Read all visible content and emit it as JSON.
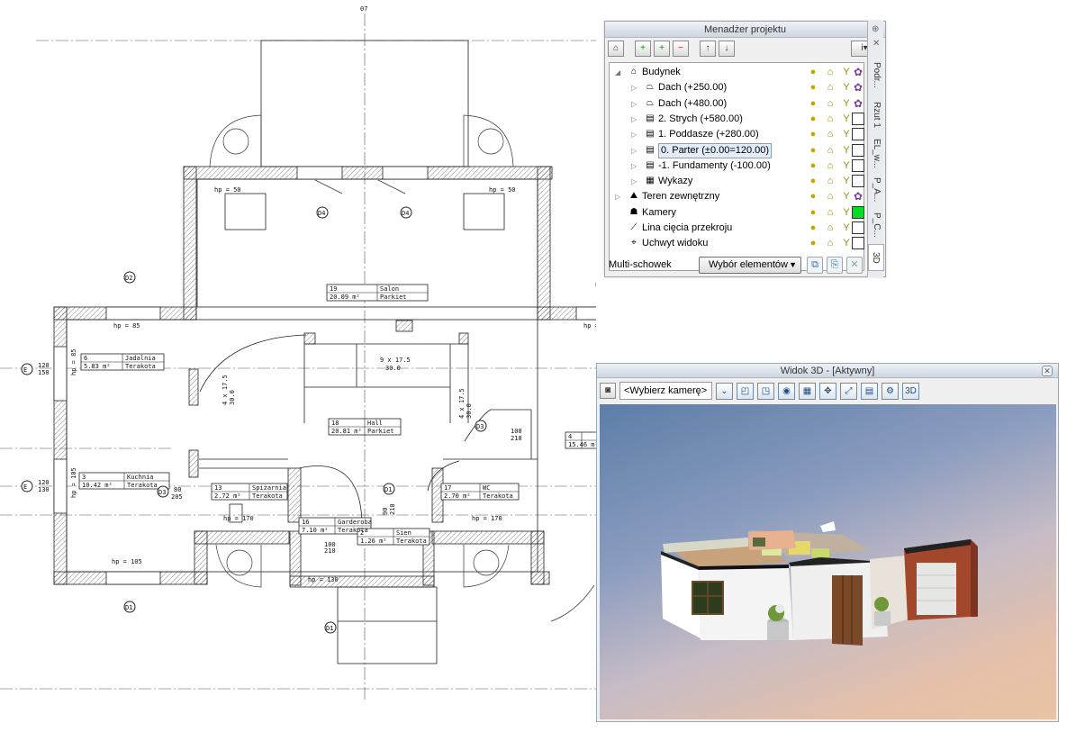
{
  "floor_plan": {
    "axis_labels": [
      "07",
      "D2",
      "D4",
      "D4",
      "D3",
      "D1",
      "D1",
      "E",
      "E",
      "D1",
      "D5",
      "D3"
    ],
    "room_labels": [
      {
        "number": "19",
        "name": "Salon",
        "area": "20.09 m²",
        "floor": "Parkiet"
      },
      {
        "number": "6",
        "name": "Jadalnia",
        "area": "5.83 m²",
        "floor": "Terakota"
      },
      {
        "number": "18",
        "name": "Hall",
        "area": "20.81 m²",
        "floor": "Parkiet"
      },
      {
        "number": "3",
        "name": "Kuchnia",
        "area": "10.42 m²",
        "floor": "Terakota"
      },
      {
        "number": "13",
        "name": "Spiżarnia",
        "area": "2.72 m²",
        "floor": "Terakota"
      },
      {
        "number": "16",
        "name": "Garderoba",
        "area": "7.10 m²",
        "floor": "Terakota"
      },
      {
        "number": "2",
        "name": "Sien",
        "area": "1.26 m²",
        "floor": "Terakota"
      },
      {
        "number": "17",
        "name": "WC",
        "area": "2.70 m²",
        "floor": "Terakota"
      },
      {
        "number": "4",
        "name": "",
        "area": "15.46 m²",
        "floor": ""
      }
    ],
    "hp_labels": [
      "hp = 50",
      "hp = 50",
      "hp = 85",
      "hp = 105",
      "hp = 85",
      "hp = 105",
      "hp = 170",
      "hp = 170",
      "hp = 105",
      "hp = 130"
    ],
    "stair_labels": [
      "9 x 17.5",
      "30.0",
      "4 x 17.5",
      "30.0",
      "4 x 17.5",
      "30.0"
    ],
    "dim_labels": [
      "120",
      "150",
      "120",
      "130",
      "100",
      "210",
      "80",
      "205",
      "100",
      "210",
      "90",
      "210"
    ]
  },
  "project_manager": {
    "title": "Menadżer projektu",
    "tree": [
      {
        "label": "Budynek",
        "level": 0,
        "expanded": true,
        "icon": "house-icon",
        "color": "palette"
      },
      {
        "label": "Dach (+250.00)",
        "level": 1,
        "icon": "roof-icon",
        "color": "palette"
      },
      {
        "label": "Dach (+480.00)",
        "level": 1,
        "icon": "roof-icon",
        "color": "palette"
      },
      {
        "label": "2. Strych (+580.00)",
        "level": 1,
        "icon": "storey-icon",
        "color": "white"
      },
      {
        "label": "1. Poddasze (+280.00)",
        "level": 1,
        "icon": "storey-icon",
        "color": "white"
      },
      {
        "label": "0. Parter (±0.00=120.00)",
        "level": 1,
        "icon": "storey-icon",
        "color": "white",
        "selected": true
      },
      {
        "label": "-1. Fundamenty (-100.00)",
        "level": 1,
        "icon": "storey-icon",
        "color": "white"
      },
      {
        "label": "Wykazy",
        "level": 1,
        "icon": "list-icon",
        "color": "white"
      },
      {
        "label": "Teren zewnętrzny",
        "level": 0,
        "icon": "terrain-icon",
        "color": "palette"
      },
      {
        "label": "Kamery",
        "level": 0,
        "icon": "camera-icon",
        "color": "#00dd22"
      },
      {
        "label": "Lina cięcia przekroju",
        "level": 0,
        "icon": "section-line-icon",
        "color": "white"
      },
      {
        "label": "Uchwyt widoku",
        "level": 0,
        "icon": "view-handle-icon",
        "color": "white"
      }
    ],
    "multi_clipboard_label": "Multi-schowek",
    "selection_dropdown": "Wybór elementów",
    "side_tabs": [
      "Podr...",
      "Rzut 1",
      "EL_w...",
      "P_A...",
      "P_C...",
      "3D"
    ]
  },
  "view3d": {
    "title": "Widok 3D - [Aktywny]",
    "camera_select": "<Wybierz kamerę>"
  },
  "colors": {
    "panel_border": "#9aa7b7",
    "selection": "#e3ecf8",
    "camera_green": "#00dd22"
  }
}
